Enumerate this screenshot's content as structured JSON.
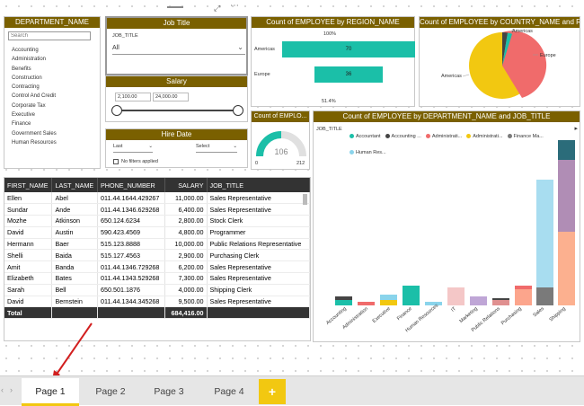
{
  "slicers": {
    "department": {
      "title": "DEPARTMENT_NAME",
      "search_placeholder": "Search",
      "items": [
        "Accounting",
        "Administration",
        "Benefits",
        "Construction",
        "Contracting",
        "Control And Credit",
        "Corporate Tax",
        "Executive",
        "Finance",
        "Government Sales",
        "Human Resources"
      ]
    },
    "job_title": {
      "title": "Job Title",
      "field": "JOB_TITLE",
      "value": "All"
    },
    "salary": {
      "title": "Salary",
      "min": "2,100.00",
      "max": "24,000.00"
    },
    "hire_date": {
      "title": "Hire Date",
      "select1": "Last",
      "select2": "Select",
      "no_filter": "No filters applied"
    }
  },
  "region_chart": {
    "title": "Count of EMPLOYEE by REGION_NAME",
    "top_label": "100%",
    "bottom_label": "51.4%",
    "categories": [
      "Americas",
      "Europe"
    ],
    "values": [
      70,
      36
    ],
    "color": "#1bbfa8"
  },
  "country_chart": {
    "title": "Count of EMPLOYEE by COUNTRY_NAME and R...",
    "labels": [
      "Americas",
      "Europe",
      "Americas",
      "Americas"
    ]
  },
  "gauge": {
    "title": "Count of EMPLO...",
    "value": "106",
    "min": "0",
    "max": "212"
  },
  "dept_job_chart": {
    "title": "Count of EMPLOYEE by DEPARTMENT_NAME and JOB_TITLE",
    "legend_field": "JOB_TITLE",
    "legend": [
      {
        "name": "Accountant",
        "color": "#1bbfa8"
      },
      {
        "name": "Accounting ...",
        "color": "#444444"
      },
      {
        "name": "Administrati...",
        "color": "#f06b6b"
      },
      {
        "name": "Administrati...",
        "color": "#f2c811"
      },
      {
        "name": "Finance Ma...",
        "color": "#7a7a7a"
      },
      {
        "name": "Human Res...",
        "color": "#8ad4eb"
      }
    ]
  },
  "employee_table": {
    "columns": [
      "FIRST_NAME",
      "LAST_NAME",
      "PHONE_NUMBER",
      "SALARY",
      "JOB_TITLE"
    ],
    "rows": [
      [
        "Ellen",
        "Abel",
        "011.44.1644.429267",
        "11,000.00",
        "Sales Representative"
      ],
      [
        "Sundar",
        "Ande",
        "011.44.1346.629268",
        "6,400.00",
        "Sales Representative"
      ],
      [
        "Mozhe",
        "Atkinson",
        "650.124.6234",
        "2,800.00",
        "Stock Clerk"
      ],
      [
        "David",
        "Austin",
        "590.423.4569",
        "4,800.00",
        "Programmer"
      ],
      [
        "Hermann",
        "Baer",
        "515.123.8888",
        "10,000.00",
        "Public Relations Representative"
      ],
      [
        "Shelli",
        "Baida",
        "515.127.4563",
        "2,900.00",
        "Purchasing Clerk"
      ],
      [
        "Amit",
        "Banda",
        "011.44.1346.729268",
        "6,200.00",
        "Sales Representative"
      ],
      [
        "Elizabeth",
        "Bates",
        "011.44.1343.529268",
        "7,300.00",
        "Sales Representative"
      ],
      [
        "Sarah",
        "Bell",
        "650.501.1876",
        "4,000.00",
        "Shipping Clerk"
      ],
      [
        "David",
        "Bernstein",
        "011.44.1344.345268",
        "9,500.00",
        "Sales Representative"
      ]
    ],
    "total_label": "Total",
    "total_salary": "684,416.00"
  },
  "tabs": [
    "Page 1",
    "Page 2",
    "Page 3",
    "Page 4"
  ],
  "add_tab_label": "+",
  "active_tab": 0
}
